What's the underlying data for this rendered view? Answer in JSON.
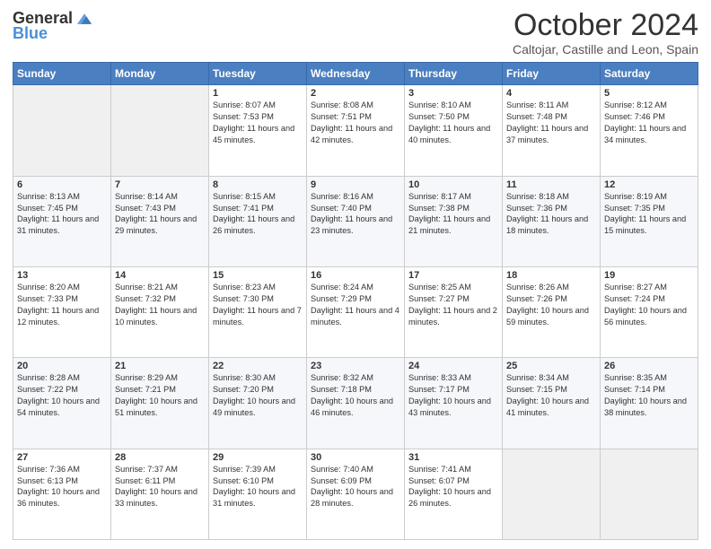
{
  "logo": {
    "general": "General",
    "blue": "Blue"
  },
  "header": {
    "month": "October 2024",
    "location": "Caltojar, Castille and Leon, Spain"
  },
  "weekdays": [
    "Sunday",
    "Monday",
    "Tuesday",
    "Wednesday",
    "Thursday",
    "Friday",
    "Saturday"
  ],
  "weeks": [
    [
      {
        "day": "",
        "info": ""
      },
      {
        "day": "",
        "info": ""
      },
      {
        "day": "1",
        "info": "Sunrise: 8:07 AM\nSunset: 7:53 PM\nDaylight: 11 hours and 45 minutes."
      },
      {
        "day": "2",
        "info": "Sunrise: 8:08 AM\nSunset: 7:51 PM\nDaylight: 11 hours and 42 minutes."
      },
      {
        "day": "3",
        "info": "Sunrise: 8:10 AM\nSunset: 7:50 PM\nDaylight: 11 hours and 40 minutes."
      },
      {
        "day": "4",
        "info": "Sunrise: 8:11 AM\nSunset: 7:48 PM\nDaylight: 11 hours and 37 minutes."
      },
      {
        "day": "5",
        "info": "Sunrise: 8:12 AM\nSunset: 7:46 PM\nDaylight: 11 hours and 34 minutes."
      }
    ],
    [
      {
        "day": "6",
        "info": "Sunrise: 8:13 AM\nSunset: 7:45 PM\nDaylight: 11 hours and 31 minutes."
      },
      {
        "day": "7",
        "info": "Sunrise: 8:14 AM\nSunset: 7:43 PM\nDaylight: 11 hours and 29 minutes."
      },
      {
        "day": "8",
        "info": "Sunrise: 8:15 AM\nSunset: 7:41 PM\nDaylight: 11 hours and 26 minutes."
      },
      {
        "day": "9",
        "info": "Sunrise: 8:16 AM\nSunset: 7:40 PM\nDaylight: 11 hours and 23 minutes."
      },
      {
        "day": "10",
        "info": "Sunrise: 8:17 AM\nSunset: 7:38 PM\nDaylight: 11 hours and 21 minutes."
      },
      {
        "day": "11",
        "info": "Sunrise: 8:18 AM\nSunset: 7:36 PM\nDaylight: 11 hours and 18 minutes."
      },
      {
        "day": "12",
        "info": "Sunrise: 8:19 AM\nSunset: 7:35 PM\nDaylight: 11 hours and 15 minutes."
      }
    ],
    [
      {
        "day": "13",
        "info": "Sunrise: 8:20 AM\nSunset: 7:33 PM\nDaylight: 11 hours and 12 minutes."
      },
      {
        "day": "14",
        "info": "Sunrise: 8:21 AM\nSunset: 7:32 PM\nDaylight: 11 hours and 10 minutes."
      },
      {
        "day": "15",
        "info": "Sunrise: 8:23 AM\nSunset: 7:30 PM\nDaylight: 11 hours and 7 minutes."
      },
      {
        "day": "16",
        "info": "Sunrise: 8:24 AM\nSunset: 7:29 PM\nDaylight: 11 hours and 4 minutes."
      },
      {
        "day": "17",
        "info": "Sunrise: 8:25 AM\nSunset: 7:27 PM\nDaylight: 11 hours and 2 minutes."
      },
      {
        "day": "18",
        "info": "Sunrise: 8:26 AM\nSunset: 7:26 PM\nDaylight: 10 hours and 59 minutes."
      },
      {
        "day": "19",
        "info": "Sunrise: 8:27 AM\nSunset: 7:24 PM\nDaylight: 10 hours and 56 minutes."
      }
    ],
    [
      {
        "day": "20",
        "info": "Sunrise: 8:28 AM\nSunset: 7:22 PM\nDaylight: 10 hours and 54 minutes."
      },
      {
        "day": "21",
        "info": "Sunrise: 8:29 AM\nSunset: 7:21 PM\nDaylight: 10 hours and 51 minutes."
      },
      {
        "day": "22",
        "info": "Sunrise: 8:30 AM\nSunset: 7:20 PM\nDaylight: 10 hours and 49 minutes."
      },
      {
        "day": "23",
        "info": "Sunrise: 8:32 AM\nSunset: 7:18 PM\nDaylight: 10 hours and 46 minutes."
      },
      {
        "day": "24",
        "info": "Sunrise: 8:33 AM\nSunset: 7:17 PM\nDaylight: 10 hours and 43 minutes."
      },
      {
        "day": "25",
        "info": "Sunrise: 8:34 AM\nSunset: 7:15 PM\nDaylight: 10 hours and 41 minutes."
      },
      {
        "day": "26",
        "info": "Sunrise: 8:35 AM\nSunset: 7:14 PM\nDaylight: 10 hours and 38 minutes."
      }
    ],
    [
      {
        "day": "27",
        "info": "Sunrise: 7:36 AM\nSunset: 6:13 PM\nDaylight: 10 hours and 36 minutes."
      },
      {
        "day": "28",
        "info": "Sunrise: 7:37 AM\nSunset: 6:11 PM\nDaylight: 10 hours and 33 minutes."
      },
      {
        "day": "29",
        "info": "Sunrise: 7:39 AM\nSunset: 6:10 PM\nDaylight: 10 hours and 31 minutes."
      },
      {
        "day": "30",
        "info": "Sunrise: 7:40 AM\nSunset: 6:09 PM\nDaylight: 10 hours and 28 minutes."
      },
      {
        "day": "31",
        "info": "Sunrise: 7:41 AM\nSunset: 6:07 PM\nDaylight: 10 hours and 26 minutes."
      },
      {
        "day": "",
        "info": ""
      },
      {
        "day": "",
        "info": ""
      }
    ]
  ]
}
